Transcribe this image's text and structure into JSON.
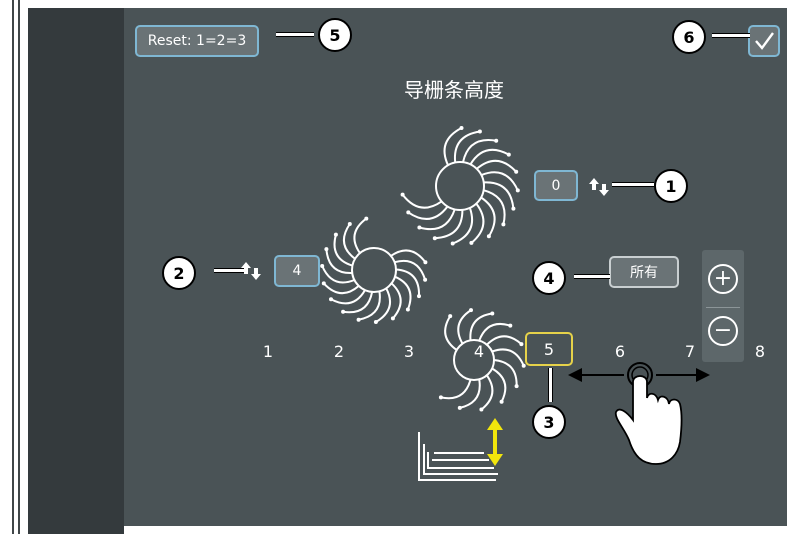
{
  "header": {
    "reset_label": "Reset: 1=2=3",
    "confirm_icon": "checkmark-icon",
    "title": "导栅条高度"
  },
  "controls": {
    "value_1": "0",
    "value_2": "4",
    "all_label": "所有",
    "selected_position": "5",
    "zoom_in_icon": "plus-icon",
    "zoom_out_icon": "minus-icon"
  },
  "positions": [
    "1",
    "2",
    "3",
    "4",
    "5",
    "6",
    "7",
    "8"
  ],
  "callouts": [
    "1",
    "2",
    "3",
    "4",
    "5",
    "6"
  ],
  "colors": {
    "screen_bg": "#4a5356",
    "button_border": "#7fb7d3",
    "selected_border": "#e6d24a",
    "arrow_yellow": "#f2e60c"
  }
}
